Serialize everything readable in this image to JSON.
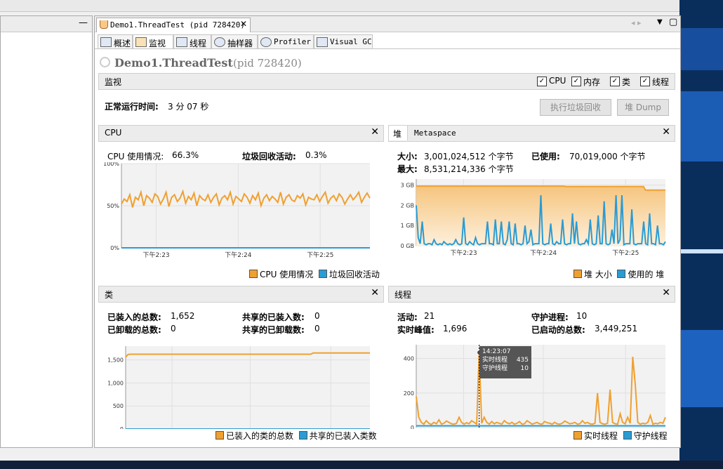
{
  "window": {
    "left_panel_minimize": "—",
    "nav_arrows": "◂ ▸",
    "dropdown": "▼",
    "restore": "▢"
  },
  "document_tab": {
    "title": "Demo1.ThreadTest (pid 728420)",
    "close": "✕"
  },
  "subtabs": [
    {
      "label": "概述"
    },
    {
      "label": "监视"
    },
    {
      "label": "线程"
    },
    {
      "label": "抽样器"
    },
    {
      "label": "Profiler"
    },
    {
      "label": "Visual GC"
    }
  ],
  "app": {
    "title": "Demo1.ThreadTest",
    "pid": "(pid 728420)"
  },
  "monitor": {
    "section_title": "监视",
    "checkboxes": [
      {
        "label": "CPU",
        "checked": true
      },
      {
        "label": "内存",
        "checked": true
      },
      {
        "label": "类",
        "checked": true
      },
      {
        "label": "线程",
        "checked": true
      }
    ],
    "uptime_label": "正常运行时间:",
    "uptime_value": "3 分 07 秒",
    "gc_button": "执行垃圾回收",
    "heap_dump_button": "堆 Dump"
  },
  "cpu_panel": {
    "title": "CPU",
    "close": "✕",
    "usage_label": "CPU 使用情况:",
    "usage_value": "66.3%",
    "gc_label": "垃圾回收活动:",
    "gc_value": "0.3%",
    "legend": [
      "CPU 使用情况",
      "垃圾回收活动"
    ],
    "colors": [
      "#f0a030",
      "#2a9bd4"
    ]
  },
  "heap_panel": {
    "tab_heap": "堆",
    "tab_metaspace": "Metaspace",
    "close": "✕",
    "size_label": "大小:",
    "size_value": "3,001,024,512 个字节",
    "max_label": "最大:",
    "max_value": "8,531,214,336 个字节",
    "used_label": "已使用:",
    "used_value": "70,019,000 个字节",
    "legend": [
      "堆 大小",
      "使用的 堆"
    ],
    "colors": [
      "#f0a030",
      "#2a9bd4"
    ]
  },
  "classes_panel": {
    "title": "类",
    "close": "✕",
    "loaded_label": "已装入的总数:",
    "loaded_value": "1,652",
    "unloaded_label": "已卸载的总数:",
    "unloaded_value": "0",
    "shared_loaded_label": "共享的已装入数:",
    "shared_loaded_value": "0",
    "shared_unloaded_label": "共享的已卸载数:",
    "shared_unloaded_value": "0",
    "legend": [
      "已装入的类的总数",
      "共享的已装入类数"
    ],
    "colors": [
      "#f0a030",
      "#2a9bd4"
    ]
  },
  "threads_panel": {
    "title": "线程",
    "close": "✕",
    "live_label": "活动:",
    "live_value": "21",
    "peak_label": "实时峰值:",
    "peak_value": "1,696",
    "daemon_label": "守护进程:",
    "daemon_value": "10",
    "started_label": "已启动的总数:",
    "started_value": "3,449,251",
    "tooltip": {
      "time": "14:23:07",
      "live_label": "实时线程",
      "live_value": "435",
      "daemon_label": "守护线程",
      "daemon_value": "10"
    },
    "legend": [
      "实时线程",
      "守护线程"
    ],
    "colors": [
      "#f0a030",
      "#2a9bd4"
    ]
  },
  "chart_data": [
    {
      "id": "cpu",
      "type": "line",
      "x_ticks": [
        "下午2:23",
        "下午2:24",
        "下午2:25"
      ],
      "y_ticks": [
        "100%",
        "50%",
        "0%"
      ],
      "ylim": [
        0,
        100
      ],
      "series": [
        {
          "name": "CPU 使用情况",
          "values": [
            52,
            58,
            55,
            63,
            48,
            60,
            57,
            66,
            50,
            62,
            59,
            54,
            64,
            61,
            52,
            58,
            66,
            49,
            60,
            63,
            55,
            59,
            67,
            53,
            61,
            57,
            65,
            50,
            62,
            58,
            56,
            63,
            54,
            60,
            64,
            51,
            59,
            62,
            57,
            66,
            52,
            61,
            58,
            55,
            64,
            60,
            53,
            62,
            57,
            65,
            50,
            59,
            63,
            56,
            61,
            58,
            54,
            66,
            52,
            60,
            63,
            57,
            55,
            62,
            59,
            64,
            51,
            60,
            58,
            57,
            63,
            55,
            61,
            66,
            53,
            59,
            62,
            56,
            64,
            60,
            52,
            58,
            63,
            57,
            61,
            66,
            54,
            60,
            65,
            59
          ]
        },
        {
          "name": "垃圾回收活动",
          "values": [
            0,
            0,
            0,
            0,
            0,
            0,
            0,
            0,
            0,
            0,
            0,
            0,
            0,
            0,
            0,
            0,
            0,
            0,
            0,
            0,
            0,
            0,
            0,
            0,
            0,
            0,
            0,
            0,
            0,
            0,
            0,
            0,
            0,
            0,
            0,
            0,
            0,
            0,
            0,
            0,
            0,
            0,
            0,
            0,
            0,
            0,
            0,
            0,
            0,
            0,
            0,
            0,
            0,
            0,
            0,
            0,
            0,
            0,
            0,
            0,
            0,
            0,
            0,
            0,
            0,
            0,
            0,
            0,
            0,
            0,
            0,
            0,
            0,
            0,
            0,
            0,
            0,
            0,
            0,
            0,
            0,
            0,
            0,
            0,
            0,
            0,
            0,
            0,
            0,
            0
          ]
        }
      ]
    },
    {
      "id": "heap",
      "type": "area",
      "x_ticks": [
        "下午2:23",
        "下午2:24",
        "下午2:25"
      ],
      "y_ticks": [
        "3 GB",
        "2 GB",
        "1 GB",
        "0 GB"
      ],
      "ylim": [
        0,
        3.3
      ],
      "series": [
        {
          "name": "堆 大小",
          "values": [
            2.95,
            2.95,
            2.95,
            2.95,
            2.95,
            2.95,
            2.95,
            2.95,
            2.95,
            2.95,
            2.95,
            2.95,
            2.95,
            2.95,
            2.95,
            2.95,
            2.95,
            2.95,
            2.95,
            2.95,
            2.95,
            2.95,
            2.95,
            2.95,
            2.95,
            2.95,
            2.95,
            2.95,
            2.95,
            2.95,
            2.95,
            2.95,
            2.95,
            2.95,
            2.95,
            2.95,
            2.95,
            2.95,
            2.95,
            2.95,
            2.95,
            2.95,
            2.95,
            2.95,
            2.95,
            2.95,
            2.95,
            2.95,
            2.95,
            2.95,
            2.95,
            2.95,
            2.95,
            2.95,
            2.95,
            2.95,
            2.95,
            2.95,
            2.95,
            2.95,
            2.95,
            2.95,
            2.95,
            2.95,
            2.95,
            2.95,
            2.95,
            2.95,
            2.95,
            2.95,
            2.95,
            2.95,
            2.95,
            2.95,
            2.95,
            2.93,
            2.93,
            2.93,
            2.93,
            2.93,
            2.93,
            2.93,
            2.93,
            2.93,
            2.93,
            2.93,
            2.93,
            2.93,
            2.93,
            2.93,
            2.93,
            2.93,
            2.93,
            2.93,
            2.93,
            2.93,
            2.93,
            2.93,
            2.93,
            2.93,
            2.93,
            2.93,
            2.93,
            2.93,
            2.93,
            2.93,
            2.93,
            2.93,
            2.93,
            2.93,
            2.93,
            2.93,
            2.93,
            2.93,
            2.93,
            2.75,
            2.75,
            2.75,
            2.75,
            2.75,
            2.75,
            2.75,
            2.75,
            2.75,
            2.75,
            2.75
          ]
        },
        {
          "name": "使用的 堆",
          "values": [
            2.0,
            0.4,
            0.1,
            1.2,
            0.1,
            0.05,
            0.1,
            0.1,
            0.05,
            0.3,
            0.1,
            0.05,
            0.1,
            0.05,
            0.2,
            0.1,
            0.05,
            0.1,
            0.05,
            0.1,
            0.3,
            0.1,
            0.05,
            0.1,
            1.4,
            0.1,
            0.05,
            0.2,
            0.1,
            0.05,
            0.4,
            0.1,
            0.05,
            0.1,
            0.1,
            0.1,
            1.2,
            0.1,
            0.1,
            0.05,
            1.3,
            0.1,
            0.1,
            1.2,
            0.1,
            0.05,
            0.3,
            1.2,
            0.1,
            0.05,
            1.1,
            0.1,
            0.1,
            0.05,
            0.1,
            1.0,
            0.1,
            0.2,
            0.8,
            0.05,
            0.1,
            0.1,
            0.1,
            2.5,
            0.1,
            0.05,
            0.1,
            0.1,
            1.1,
            0.1,
            0.05,
            0.2,
            0.1,
            0.1,
            1.3,
            0.1,
            0.05,
            0.1,
            0.1,
            1.6,
            0.1,
            1.2,
            0.1,
            0.05,
            0.1,
            0.1,
            0.3,
            0.1,
            1.3,
            0.1,
            0.05,
            0.1,
            1.5,
            0.1,
            0.1,
            2.2,
            0.1,
            0.05,
            0.1,
            0.8,
            0.1,
            2.5,
            0.1,
            0.3,
            2.5,
            0.05,
            0.1,
            0.1,
            0.1,
            1.8,
            0.1,
            0.05,
            0.1,
            0.1,
            0.1,
            1.2,
            0.1,
            0.05,
            1.6,
            0.1,
            0.1,
            0.05,
            1.0,
            0.1,
            0.1,
            0.05,
            0.2
          ]
        }
      ]
    },
    {
      "id": "classes",
      "type": "line",
      "x_ticks": [
        "下午2:23",
        "下午2:24",
        "下午2:25"
      ],
      "y_ticks": [
        "1,500",
        "1,000",
        "500",
        "0"
      ],
      "ylim": [
        0,
        1800
      ],
      "series": [
        {
          "name": "已装入的类的总数",
          "values": [
            1560,
            1620,
            1625,
            1625,
            1625,
            1625,
            1625,
            1625,
            1625,
            1625,
            1625,
            1625,
            1625,
            1625,
            1625,
            1625,
            1625,
            1625,
            1625,
            1625,
            1625,
            1625,
            1625,
            1625,
            1625,
            1625,
            1625,
            1625,
            1625,
            1625,
            1625,
            1625,
            1625,
            1625,
            1625,
            1625,
            1625,
            1625,
            1625,
            1625,
            1625,
            1625,
            1625,
            1625,
            1625,
            1625,
            1625,
            1625,
            1625,
            1625,
            1625,
            1625,
            1625,
            1625,
            1625,
            1625,
            1625,
            1625,
            1625,
            1625,
            1625,
            1625,
            1625,
            1625,
            1625,
            1625,
            1625,
            1625,
            1625,
            1625,
            1625,
            1625,
            1625,
            1625,
            1625,
            1625,
            1650,
            1652,
            1652,
            1652,
            1652,
            1652,
            1652,
            1652,
            1652,
            1652,
            1652,
            1652,
            1652,
            1652,
            1652,
            1652,
            1652,
            1652,
            1652,
            1652,
            1652,
            1652,
            1652,
            1652
          ]
        },
        {
          "name": "共享的已装入类数",
          "values": [
            0,
            0,
            0,
            0,
            0,
            0,
            0,
            0,
            0,
            0,
            0,
            0,
            0,
            0,
            0,
            0,
            0,
            0,
            0,
            0,
            0,
            0,
            0,
            0,
            0,
            0,
            0,
            0,
            0,
            0,
            0,
            0,
            0,
            0,
            0,
            0,
            0,
            0,
            0,
            0,
            0,
            0,
            0,
            0,
            0,
            0,
            0,
            0,
            0,
            0,
            0,
            0,
            0,
            0,
            0,
            0,
            0,
            0,
            0,
            0,
            0,
            0,
            0,
            0,
            0,
            0,
            0,
            0,
            0,
            0,
            0,
            0,
            0,
            0,
            0,
            0,
            0,
            0,
            0,
            0,
            0,
            0,
            0,
            0,
            0,
            0,
            0,
            0,
            0,
            0,
            0,
            0,
            0,
            0,
            0,
            0,
            0,
            0,
            0,
            0
          ]
        }
      ]
    },
    {
      "id": "threads",
      "type": "line",
      "x_ticks": [
        "下午2:23",
        "下午2:24",
        "下午2:25"
      ],
      "y_ticks": [
        "400",
        "200",
        "0"
      ],
      "ylim": [
        0,
        480
      ],
      "series": [
        {
          "name": "实时线程",
          "values": [
            180,
            60,
            30,
            20,
            40,
            25,
            18,
            30,
            22,
            45,
            20,
            25,
            38,
            30,
            22,
            20,
            25,
            60,
            30,
            20,
            28,
            22,
            40,
            30,
            20,
            435,
            25,
            60,
            30,
            20,
            35,
            22,
            30,
            25,
            20,
            40,
            28,
            22,
            30,
            20,
            25,
            35,
            20,
            22,
            40,
            30,
            20,
            25,
            30,
            22,
            20,
            35,
            28,
            25,
            20,
            30,
            22,
            20,
            25,
            38,
            30,
            22,
            25,
            30,
            20,
            22,
            40,
            25,
            30,
            22,
            20,
            25,
            200,
            30,
            22,
            20,
            25,
            220,
            30,
            22,
            20,
            80,
            30,
            22,
            60,
            25,
            410,
            250,
            30,
            20,
            25,
            22,
            30,
            70,
            20,
            25,
            22,
            30,
            25,
            60
          ]
        },
        {
          "name": "守护线程",
          "values": [
            10,
            10,
            10,
            10,
            10,
            10,
            10,
            10,
            10,
            10,
            10,
            10,
            10,
            10,
            10,
            10,
            10,
            10,
            10,
            10,
            10,
            10,
            10,
            10,
            10,
            10,
            10,
            10,
            10,
            10,
            10,
            10,
            10,
            10,
            10,
            10,
            10,
            10,
            10,
            10,
            10,
            10,
            10,
            10,
            10,
            10,
            10,
            10,
            10,
            10,
            10,
            10,
            10,
            10,
            10,
            10,
            10,
            10,
            10,
            10,
            10,
            10,
            10,
            10,
            10,
            10,
            10,
            10,
            10,
            10,
            10,
            10,
            10,
            10,
            10,
            10,
            10,
            10,
            10,
            10,
            10,
            10,
            10,
            10,
            10,
            10,
            10,
            10,
            10,
            10,
            10,
            10,
            10,
            10,
            10,
            10,
            10,
            10,
            10,
            10
          ]
        }
      ]
    }
  ]
}
